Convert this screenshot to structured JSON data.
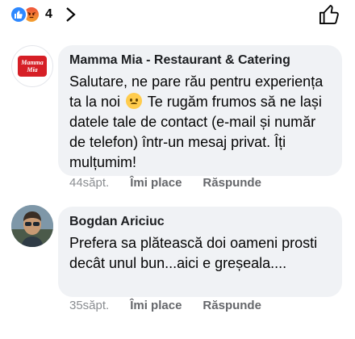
{
  "reactions": {
    "icons": [
      "like-icon",
      "angry-icon"
    ],
    "count": "4",
    "like_color": "#2d88ff",
    "angry_color": "#f0533a"
  },
  "comments": [
    {
      "author": "Mamma Mia - Restaurant & Catering",
      "avatar_text": "Mamma Mia",
      "text_before": "Salutare, ne pare rău pentru experiența ta la noi",
      "emoji": "disappointed-face-emoji",
      "text_after": "Te rugăm frumos să ne lași datele tale de contact (e-mail și număr de telefon) într-un mesaj privat. Îți mulțumim!",
      "time": "44săpt.",
      "like_label": "Îmi place",
      "reply_label": "Răspunde"
    },
    {
      "author": "Bogdan Ariciuc",
      "text": "Prefera sa plătească doi oameni prosti decât unul bun...aici e greșeala....",
      "time": "35săpt.",
      "like_label": "Îmi place",
      "reply_label": "Răspunde"
    }
  ]
}
